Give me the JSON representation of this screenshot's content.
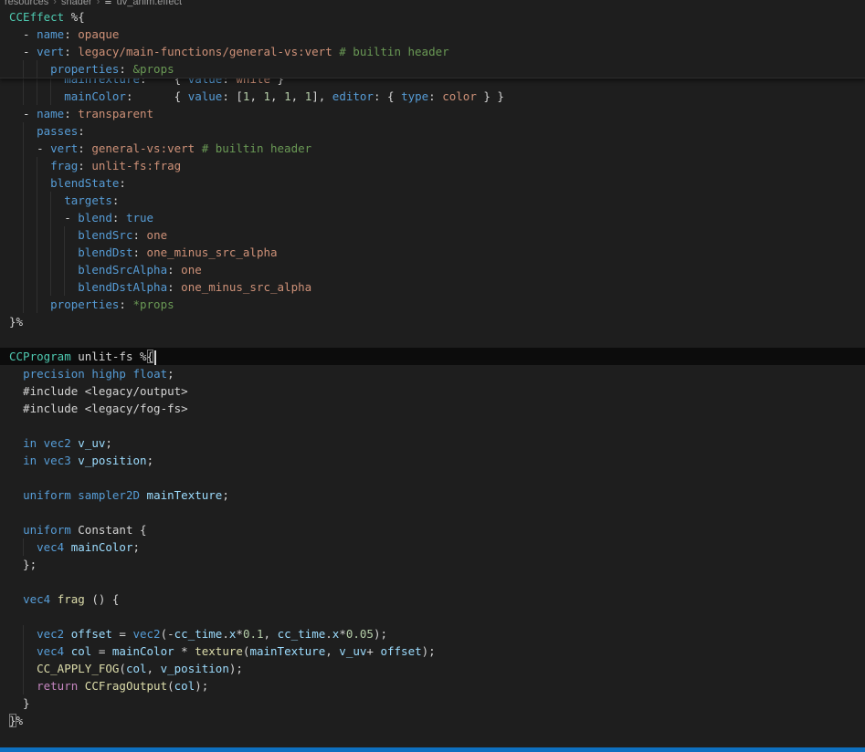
{
  "palette": {
    "fg": "#d4d4d4",
    "blue": "#569cd6",
    "lblue": "#9cdcfe",
    "teal": "#4ec9b0",
    "orange": "#ce9178",
    "green": "#6a9955",
    "num": "#b5cea8",
    "mag": "#c586c0",
    "yellow": "#dcdcaa",
    "bg": "#1e1e1e",
    "current_line_bg": "#0c0c0c",
    "guide": "#303030",
    "caret": "#d7d7d7",
    "bracket_match_border": "#7a7a7a",
    "sticky_border": "#2c2c2c",
    "statusbar_blue": "#0e70c0",
    "breadcrumb_fg": "#9d9d9d"
  },
  "breadcrumb": {
    "items": [
      "resources",
      "shader",
      "uv_anim.effect"
    ],
    "separator": "›",
    "file_icon": "≣"
  },
  "editor": {
    "sticky_lines": [
      {
        "tokens": [
          [
            "teal",
            "CCEffect"
          ],
          [
            "fg",
            " %{"
          ]
        ]
      },
      {
        "tokens": [
          [
            "fg",
            "  - "
          ],
          [
            "blue",
            "name"
          ],
          [
            "fg",
            ":"
          ],
          [
            "orange",
            " opaque"
          ]
        ]
      },
      {
        "tokens": [
          [
            "fg",
            "  - "
          ],
          [
            "blue",
            "vert"
          ],
          [
            "fg",
            ":"
          ],
          [
            "orange",
            " legacy/main-functions/general-vs:vert "
          ],
          [
            "green",
            "# builtin header"
          ]
        ]
      },
      {
        "tokens": [
          [
            "fg",
            "      "
          ],
          [
            "blue",
            "properties"
          ],
          [
            "fg",
            ":"
          ],
          [
            "green",
            " &props"
          ]
        ]
      }
    ],
    "lines": [
      {
        "tokens": [
          [
            "fg",
            "        "
          ],
          [
            "blue",
            "mainTexture"
          ],
          [
            "fg",
            ":    { "
          ],
          [
            "blue",
            "value"
          ],
          [
            "fg",
            ":"
          ],
          [
            "orange",
            " white"
          ],
          [
            "fg",
            " }"
          ]
        ]
      },
      {
        "tokens": [
          [
            "fg",
            "        "
          ],
          [
            "blue",
            "mainColor"
          ],
          [
            "fg",
            ":      { "
          ],
          [
            "blue",
            "value"
          ],
          [
            "fg",
            ": ["
          ],
          [
            "num",
            "1"
          ],
          [
            "fg",
            ", "
          ],
          [
            "num",
            "1"
          ],
          [
            "fg",
            ", "
          ],
          [
            "num",
            "1"
          ],
          [
            "fg",
            ", "
          ],
          [
            "num",
            "1"
          ],
          [
            "fg",
            "], "
          ],
          [
            "blue",
            "editor"
          ],
          [
            "fg",
            ": { "
          ],
          [
            "blue",
            "type"
          ],
          [
            "fg",
            ":"
          ],
          [
            "orange",
            " color"
          ],
          [
            "fg",
            " } }"
          ]
        ]
      },
      {
        "tokens": [
          [
            "fg",
            "  - "
          ],
          [
            "blue",
            "name"
          ],
          [
            "fg",
            ":"
          ],
          [
            "orange",
            " transparent"
          ]
        ]
      },
      {
        "tokens": [
          [
            "fg",
            "    "
          ],
          [
            "blue",
            "passes"
          ],
          [
            "fg",
            ":"
          ]
        ]
      },
      {
        "tokens": [
          [
            "fg",
            "    - "
          ],
          [
            "blue",
            "vert"
          ],
          [
            "fg",
            ":"
          ],
          [
            "orange",
            " general-vs:vert "
          ],
          [
            "green",
            "# builtin header"
          ]
        ]
      },
      {
        "tokens": [
          [
            "fg",
            "      "
          ],
          [
            "blue",
            "frag"
          ],
          [
            "fg",
            ":"
          ],
          [
            "orange",
            " unlit-fs:frag"
          ]
        ]
      },
      {
        "tokens": [
          [
            "fg",
            "      "
          ],
          [
            "blue",
            "blendState"
          ],
          [
            "fg",
            ":"
          ]
        ]
      },
      {
        "tokens": [
          [
            "fg",
            "        "
          ],
          [
            "blue",
            "targets"
          ],
          [
            "fg",
            ":"
          ]
        ]
      },
      {
        "tokens": [
          [
            "fg",
            "        - "
          ],
          [
            "blue",
            "blend"
          ],
          [
            "fg",
            ":"
          ],
          [
            "blue",
            " true"
          ]
        ]
      },
      {
        "tokens": [
          [
            "fg",
            "          "
          ],
          [
            "blue",
            "blendSrc"
          ],
          [
            "fg",
            ":"
          ],
          [
            "orange",
            " one"
          ]
        ]
      },
      {
        "tokens": [
          [
            "fg",
            "          "
          ],
          [
            "blue",
            "blendDst"
          ],
          [
            "fg",
            ":"
          ],
          [
            "orange",
            " one_minus_src_alpha"
          ]
        ]
      },
      {
        "tokens": [
          [
            "fg",
            "          "
          ],
          [
            "blue",
            "blendSrcAlpha"
          ],
          [
            "fg",
            ":"
          ],
          [
            "orange",
            " one"
          ]
        ]
      },
      {
        "tokens": [
          [
            "fg",
            "          "
          ],
          [
            "blue",
            "blendDstAlpha"
          ],
          [
            "fg",
            ":"
          ],
          [
            "orange",
            " one_minus_src_alpha"
          ]
        ]
      },
      {
        "tokens": [
          [
            "fg",
            "      "
          ],
          [
            "blue",
            "properties"
          ],
          [
            "fg",
            ":"
          ],
          [
            "green",
            " *props"
          ]
        ]
      },
      {
        "tokens": [
          [
            "fg",
            "}%"
          ]
        ]
      },
      {
        "tokens": []
      },
      {
        "tokens": [
          [
            "teal",
            "CCProgram"
          ],
          [
            "fg",
            " unlit-fs %"
          ],
          [
            "fg",
            "{",
            "box"
          ],
          [
            "caret",
            ""
          ]
        ],
        "current": true
      },
      {
        "tokens": [
          [
            "fg",
            "  "
          ],
          [
            "blue",
            "precision"
          ],
          [
            "fg",
            " "
          ],
          [
            "blue",
            "highp"
          ],
          [
            "fg",
            " "
          ],
          [
            "blue",
            "float"
          ],
          [
            "fg",
            ";"
          ]
        ]
      },
      {
        "tokens": [
          [
            "fg",
            "  #include <legacy/output>"
          ]
        ]
      },
      {
        "tokens": [
          [
            "fg",
            "  #include <legacy/fog-fs>"
          ]
        ]
      },
      {
        "tokens": []
      },
      {
        "tokens": [
          [
            "fg",
            "  "
          ],
          [
            "blue",
            "in"
          ],
          [
            "fg",
            " "
          ],
          [
            "blue",
            "vec2"
          ],
          [
            "fg",
            " "
          ],
          [
            "lblue",
            "v_uv"
          ],
          [
            "fg",
            ";"
          ]
        ]
      },
      {
        "tokens": [
          [
            "fg",
            "  "
          ],
          [
            "blue",
            "in"
          ],
          [
            "fg",
            " "
          ],
          [
            "blue",
            "vec3"
          ],
          [
            "fg",
            " "
          ],
          [
            "lblue",
            "v_position"
          ],
          [
            "fg",
            ";"
          ]
        ]
      },
      {
        "tokens": []
      },
      {
        "tokens": [
          [
            "fg",
            "  "
          ],
          [
            "blue",
            "uniform"
          ],
          [
            "fg",
            " "
          ],
          [
            "blue",
            "sampler2D"
          ],
          [
            "fg",
            " "
          ],
          [
            "lblue",
            "mainTexture"
          ],
          [
            "fg",
            ";"
          ]
        ]
      },
      {
        "tokens": []
      },
      {
        "tokens": [
          [
            "fg",
            "  "
          ],
          [
            "blue",
            "uniform"
          ],
          [
            "fg",
            " Constant {"
          ]
        ]
      },
      {
        "tokens": [
          [
            "fg",
            "    "
          ],
          [
            "blue",
            "vec4"
          ],
          [
            "fg",
            " "
          ],
          [
            "lblue",
            "mainColor"
          ],
          [
            "fg",
            ";"
          ]
        ]
      },
      {
        "tokens": [
          [
            "fg",
            "  };"
          ]
        ]
      },
      {
        "tokens": []
      },
      {
        "tokens": [
          [
            "fg",
            "  "
          ],
          [
            "blue",
            "vec4"
          ],
          [
            "fg",
            " "
          ],
          [
            "yellow",
            "frag"
          ],
          [
            "fg",
            " () {"
          ]
        ]
      },
      {
        "tokens": []
      },
      {
        "tokens": [
          [
            "fg",
            "    "
          ],
          [
            "blue",
            "vec2"
          ],
          [
            "fg",
            " "
          ],
          [
            "lblue",
            "offset"
          ],
          [
            "fg",
            " = "
          ],
          [
            "blue",
            "vec2"
          ],
          [
            "fg",
            "(-"
          ],
          [
            "lblue",
            "cc_time"
          ],
          [
            "fg",
            "."
          ],
          [
            "lblue",
            "x"
          ],
          [
            "fg",
            "*"
          ],
          [
            "num",
            "0.1"
          ],
          [
            "fg",
            ", "
          ],
          [
            "lblue",
            "cc_time"
          ],
          [
            "fg",
            "."
          ],
          [
            "lblue",
            "x"
          ],
          [
            "fg",
            "*"
          ],
          [
            "num",
            "0.05"
          ],
          [
            "fg",
            ");"
          ]
        ]
      },
      {
        "tokens": [
          [
            "fg",
            "    "
          ],
          [
            "blue",
            "vec4"
          ],
          [
            "fg",
            " "
          ],
          [
            "lblue",
            "col"
          ],
          [
            "fg",
            " = "
          ],
          [
            "lblue",
            "mainColor"
          ],
          [
            "fg",
            " * "
          ],
          [
            "yellow",
            "texture"
          ],
          [
            "fg",
            "("
          ],
          [
            "lblue",
            "mainTexture"
          ],
          [
            "fg",
            ", "
          ],
          [
            "lblue",
            "v_uv"
          ],
          [
            "fg",
            "+ "
          ],
          [
            "lblue",
            "offset"
          ],
          [
            "fg",
            ");"
          ]
        ]
      },
      {
        "tokens": [
          [
            "fg",
            "    "
          ],
          [
            "yellow",
            "CC_APPLY_FOG"
          ],
          [
            "fg",
            "("
          ],
          [
            "lblue",
            "col"
          ],
          [
            "fg",
            ", "
          ],
          [
            "lblue",
            "v_position"
          ],
          [
            "fg",
            ");"
          ]
        ]
      },
      {
        "tokens": [
          [
            "fg",
            "    "
          ],
          [
            "mag",
            "return"
          ],
          [
            "fg",
            " "
          ],
          [
            "yellow",
            "CCFragOutput"
          ],
          [
            "fg",
            "("
          ],
          [
            "lblue",
            "col"
          ],
          [
            "fg",
            ");"
          ]
        ]
      },
      {
        "tokens": [
          [
            "fg",
            "  }"
          ]
        ]
      },
      {
        "tokens": [
          [
            "fg",
            "}",
            "box"
          ],
          [
            "fg",
            "%"
          ]
        ]
      }
    ]
  }
}
